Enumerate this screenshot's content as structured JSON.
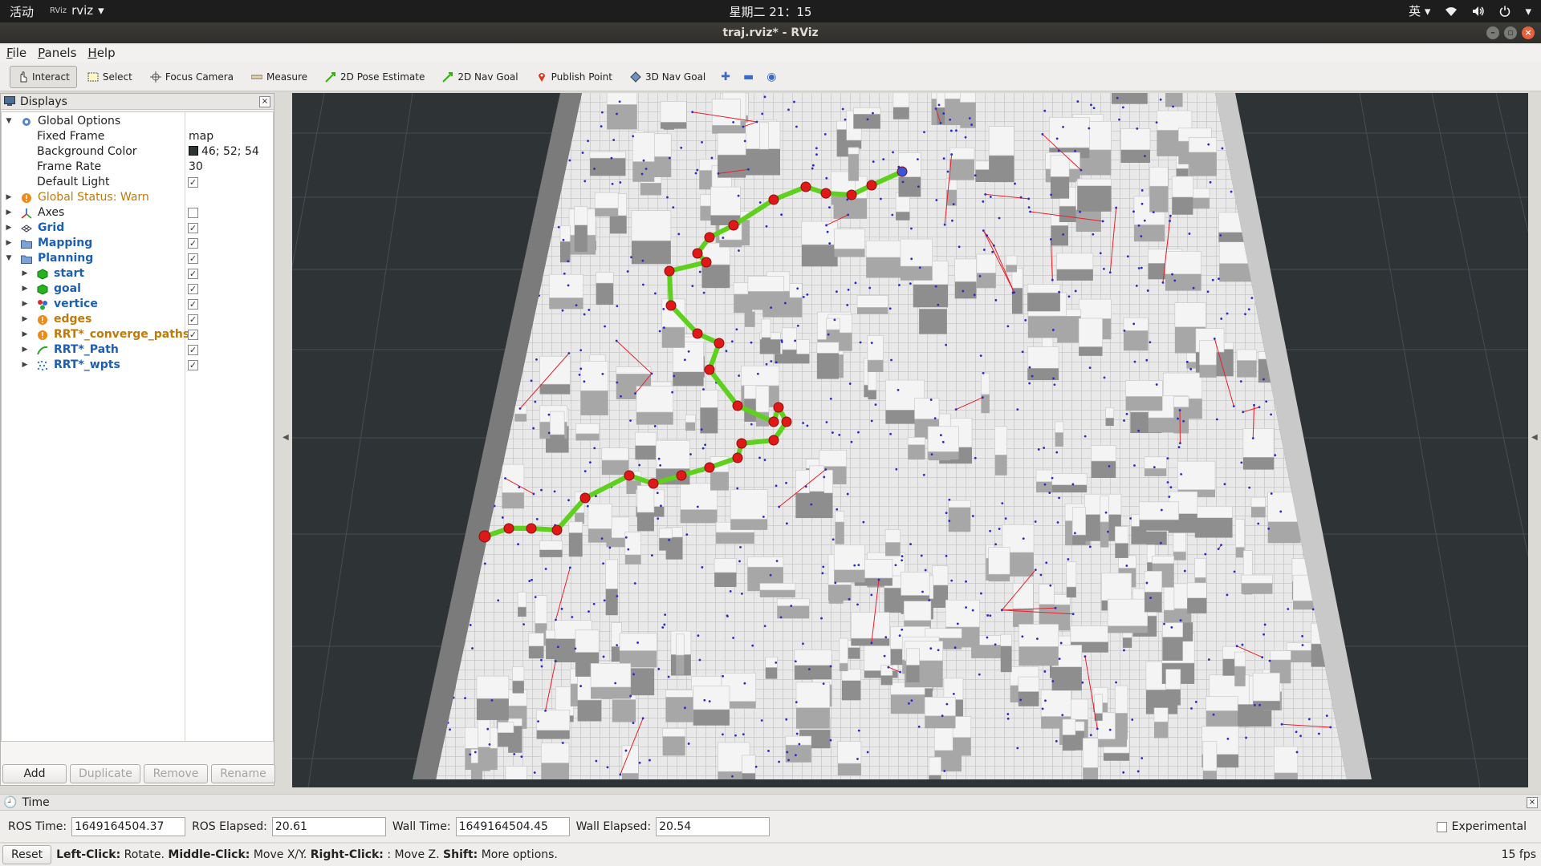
{
  "topbar": {
    "activities": "活动",
    "app_icon": "RViz",
    "app_name": "rviz",
    "clock": "星期二 21：15",
    "input_method": "英"
  },
  "window": {
    "title": "traj.rviz* - RViz"
  },
  "menu": [
    "File",
    "Panels",
    "Help"
  ],
  "toolbar": {
    "interact": "Interact",
    "select": "Select",
    "focus_camera": "Focus Camera",
    "measure": "Measure",
    "pose_estimate": "2D Pose Estimate",
    "nav_goal_2d": "2D Nav Goal",
    "publish_point": "Publish Point",
    "nav_goal_3d": "3D Nav Goal"
  },
  "displays": {
    "title": "Displays",
    "global_options": {
      "label": "Global Options",
      "fixed_frame_label": "Fixed Frame",
      "fixed_frame": "map",
      "bg_color_label": "Background Color",
      "bg_color": "46; 52; 54",
      "frame_rate_label": "Frame Rate",
      "frame_rate": "30",
      "default_light_label": "Default Light"
    },
    "global_status": "Global Status: Warn",
    "items": {
      "axes": "Axes",
      "grid": "Grid",
      "mapping": "Mapping",
      "planning": "Planning",
      "start": "start",
      "goal": "goal",
      "vertice": "vertice",
      "edges": "edges",
      "converge": "RRT*_converge_paths",
      "path": "RRT*_Path",
      "wpts": "RRT*_wpts"
    },
    "buttons": {
      "add": "Add",
      "duplicate": "Duplicate",
      "remove": "Remove",
      "rename": "Rename"
    }
  },
  "time": {
    "title": "Time",
    "ros_time_label": "ROS Time:",
    "ros_time": "1649164504.37",
    "ros_elapsed_label": "ROS Elapsed:",
    "ros_elapsed": "20.61",
    "wall_time_label": "Wall Time:",
    "wall_time": "1649164504.45",
    "wall_elapsed_label": "Wall Elapsed:",
    "wall_elapsed": "20.54",
    "experimental": "Experimental"
  },
  "status": {
    "reset": "Reset",
    "left_click": "Left-Click:",
    "left_text": "Rotate.",
    "middle_click": "Middle-Click:",
    "middle_text": "Move X/Y.",
    "right_click": "Right-Click:",
    "right_text": ": Move Z.",
    "shift": "Shift:",
    "shift_text": "More options.",
    "fps": "15 fps"
  },
  "colors": {
    "background": "#2e3436",
    "edges": "#e8202a",
    "path": "#5fd01e",
    "waypoints": "#e01818"
  }
}
